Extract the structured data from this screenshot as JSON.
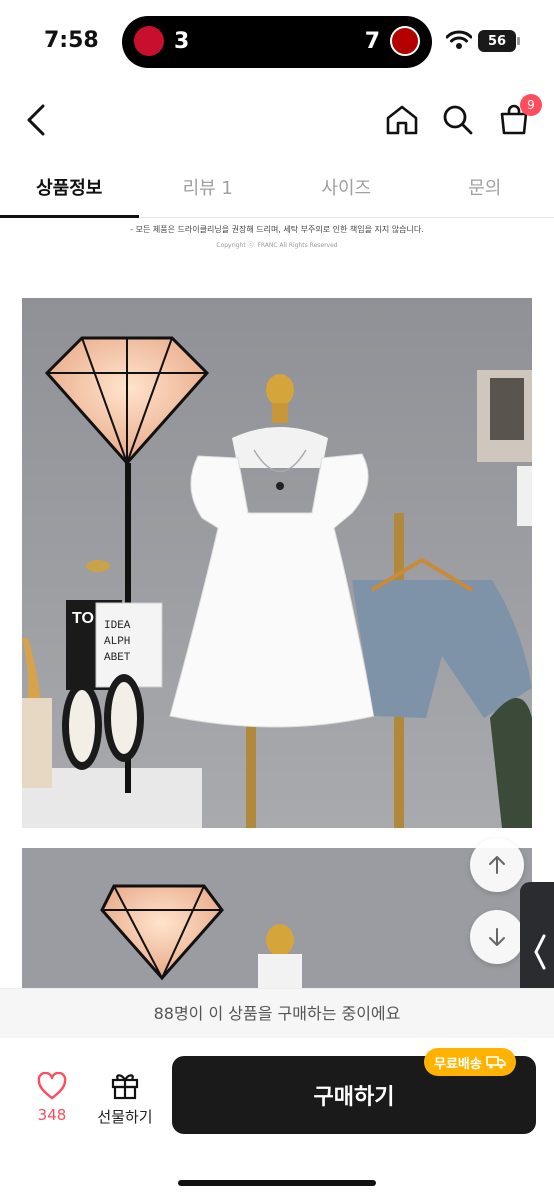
{
  "status_bar": {
    "time": "7:58",
    "live_activity": {
      "home_score": "3",
      "away_score": "7"
    },
    "battery": "56"
  },
  "header": {
    "cart_badge": "9"
  },
  "tabs": [
    {
      "label": "상품정보",
      "active": true
    },
    {
      "label": "리뷰 1",
      "active": false
    },
    {
      "label": "사이즈",
      "active": false
    },
    {
      "label": "문의",
      "active": false
    }
  ],
  "notice": {
    "line1": "- 모든 제품은 드라이클리닝을 권장해 드리며, 세탁 부주의로 인한 책임을 지지 않습니다.",
    "copyright": "Copyright ⓒ. FRANC All Rights Reserved"
  },
  "product_photo": {
    "props": {
      "book_title": "TO FO",
      "card_text": [
        "IDEA",
        "ALPH",
        "ABET"
      ]
    }
  },
  "buying_now": "88명이 이 상품을 구매하는 중이에요",
  "bottom_bar": {
    "like_count": "348",
    "gift_label": "선물하기",
    "buy_label": "구매하기",
    "free_shipping_label": "무료배송"
  },
  "colors": {
    "accent_red": "#ff4d5e",
    "buy_button": "#1a1a1a",
    "free_ship_badge": "#ffb300"
  }
}
